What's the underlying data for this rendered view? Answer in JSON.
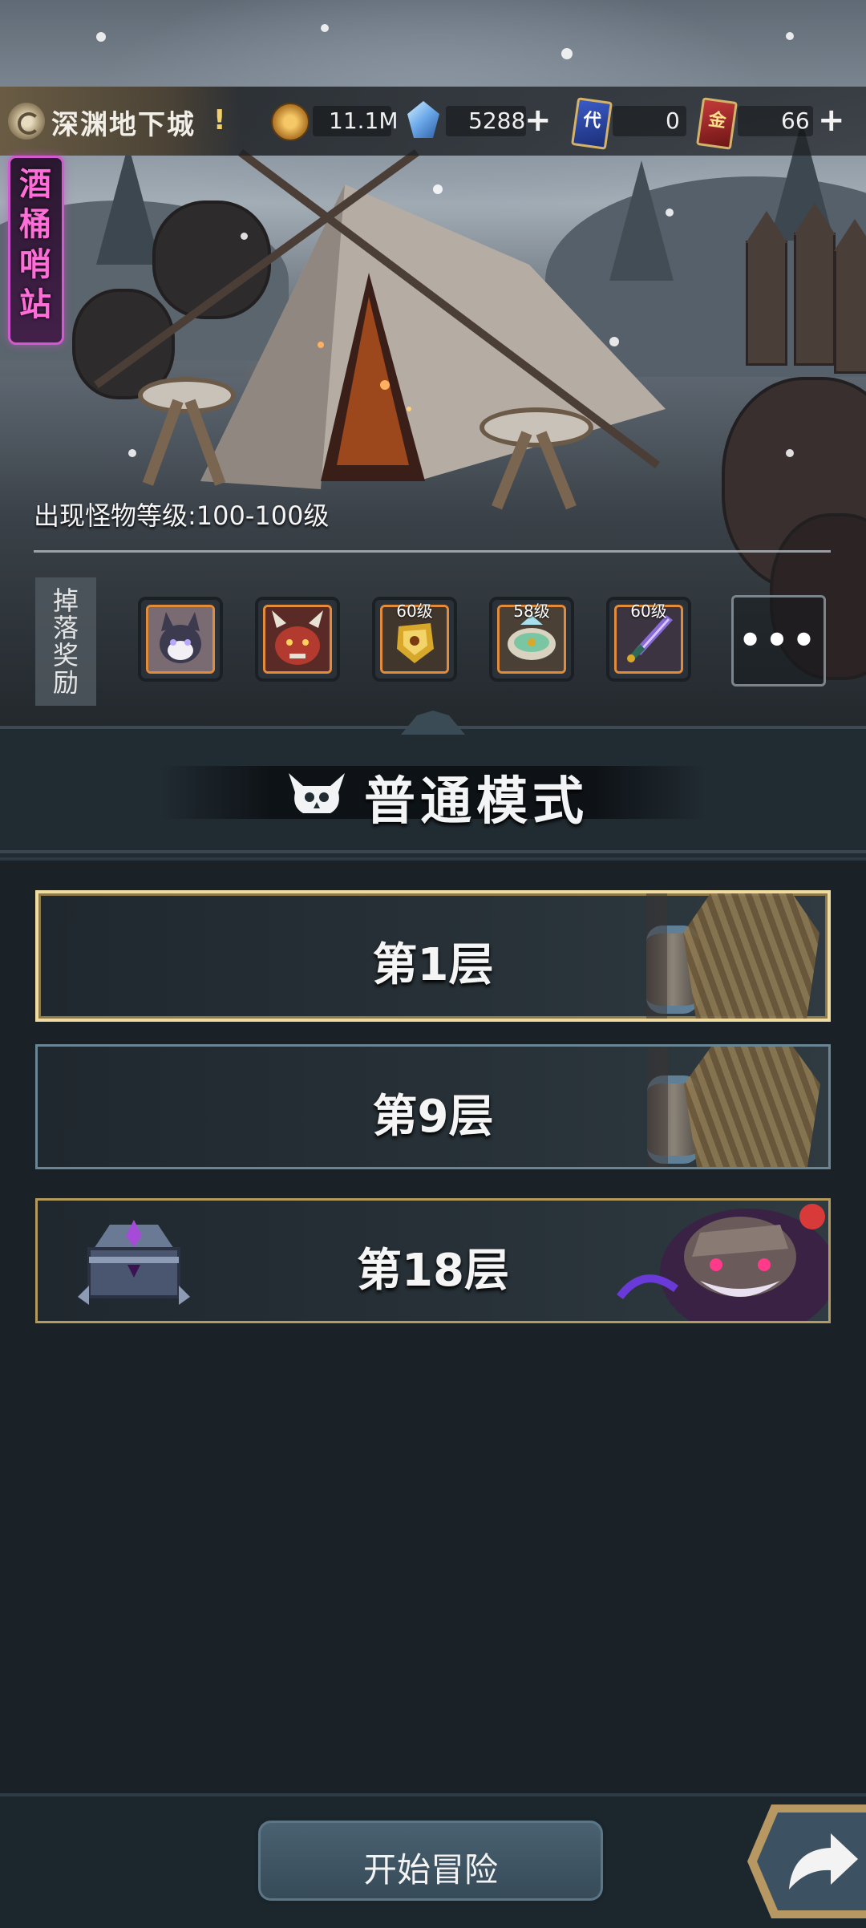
{
  "header": {
    "dungeon_title": "深渊地下城",
    "info_symbol": "!",
    "resources": {
      "coin": "11.1M",
      "gem": "5288",
      "blue_card_icon_char": "代",
      "blue_card": "0",
      "red_card_icon_char": "金",
      "red_card": "66"
    }
  },
  "side_banner": {
    "text": "酒桶哨站"
  },
  "scene": {
    "monster_level": "出现怪物等级:100-100级"
  },
  "rewards": {
    "label": "掉落奖励",
    "items": [
      {
        "name": "monster-portrait-reward",
        "level": ""
      },
      {
        "name": "dragon-portrait-reward",
        "level": ""
      },
      {
        "name": "gauntlet-reward",
        "level": "60级"
      },
      {
        "name": "armor-reward",
        "level": "58级"
      },
      {
        "name": "dagger-reward",
        "level": "60级"
      }
    ],
    "more": "•••"
  },
  "mode": {
    "title": "普通模式"
  },
  "floors": [
    {
      "label": "第1层"
    },
    {
      "label": "第9层"
    },
    {
      "label": "第18层"
    }
  ],
  "actions": {
    "start_label": "开始冒险"
  },
  "colors": {
    "accent_gold": "#f0dca0",
    "reward_border": "#e28c3a",
    "banner_pink": "#ff6ed8",
    "panel_bg": "#1a2227"
  }
}
